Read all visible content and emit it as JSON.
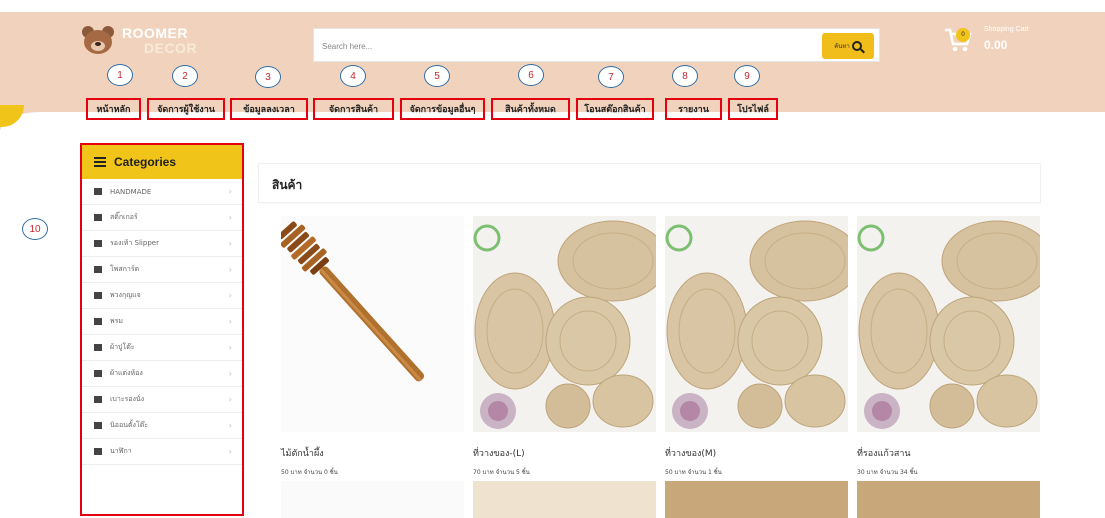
{
  "header": {
    "logo_line1": "ROOMER",
    "logo_line2": "DECOR",
    "search_placeholder": "Search here...",
    "search_button_label": "ค้นหา",
    "cart_title": "Shopping Cart",
    "cart_badge": "0",
    "cart_total": "0.00"
  },
  "nav": [
    {
      "label": "หน้าหลัก"
    },
    {
      "label": "จัดการผู้ใช้งาน"
    },
    {
      "label": "ข้อมูลลงเวลา"
    },
    {
      "label": "จัดการสินค้า"
    },
    {
      "label": "จัดการข้อมูลอื่นๆ"
    },
    {
      "label": "สินค้าทั้งหมด"
    },
    {
      "label": "โอนสต๊อกสินค้า"
    },
    {
      "label": "รายงาน"
    },
    {
      "label": "โปรไฟล์"
    }
  ],
  "callouts": [
    "1",
    "2",
    "3",
    "4",
    "5",
    "6",
    "7",
    "8",
    "9",
    "10"
  ],
  "categories": {
    "title": "Categories",
    "items": [
      {
        "label": "HANDMADE"
      },
      {
        "label": "สติ๊กเกอร์"
      },
      {
        "label": "รองเท้า Slipper"
      },
      {
        "label": "โพสการ์ด"
      },
      {
        "label": "พวงกุญแจ"
      },
      {
        "label": "พรม"
      },
      {
        "label": "ผ้าปูโต๊ะ"
      },
      {
        "label": "ผ้าแต่งห้อง"
      },
      {
        "label": "เบาะรองนั่ง"
      },
      {
        "label": "นิออนตั้งโต๊ะ"
      },
      {
        "label": "นาฬิกา"
      }
    ]
  },
  "main": {
    "title": "สินค้า",
    "products": [
      {
        "name": "ไม้ตักน้ำผึ้ง",
        "meta": "50 บาท จำนวน 0  ชิ้น",
        "image": "honey-dipper"
      },
      {
        "name": "ที่วางของ-(L)",
        "meta": "70 บาท จำนวน 5  ชิ้น",
        "image": "woven-placemats"
      },
      {
        "name": "ที่วางของ(M)",
        "meta": "50 บาท จำนวน 1  ชิ้น",
        "image": "woven-placemats"
      },
      {
        "name": "ที่รองแก้วสาน",
        "meta": "30 บาท จำนวน 34  ชิ้น",
        "image": "woven-placemats"
      }
    ]
  },
  "colors": {
    "header_bg": "#f1d3bd",
    "accent_yellow": "#f0c418",
    "annotation_red": "#e3000f",
    "callout_blue": "#2f6ea8"
  }
}
